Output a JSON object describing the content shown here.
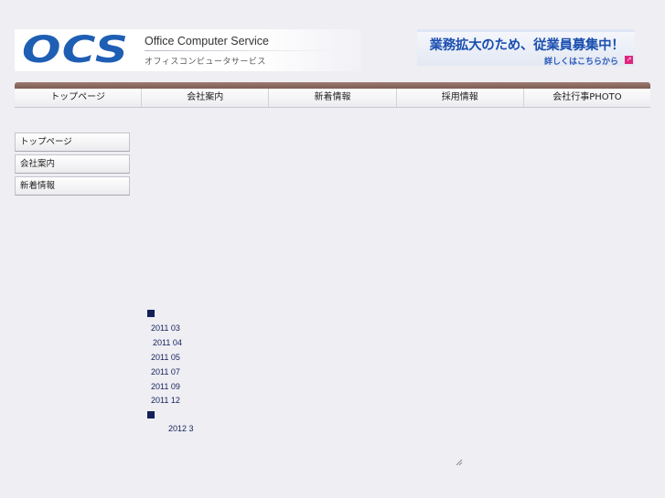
{
  "header": {
    "logo_text": "OCS",
    "company_name_en": "Office Computer Service",
    "company_name_ja": "オフィスコンピュータサービス"
  },
  "banner": {
    "headline": "業務拡大のため、従業員募集中！",
    "link_text": "詳しくはこちらから",
    "arrow_glyph": "↗"
  },
  "top_nav": {
    "items": [
      {
        "label": "トップページ"
      },
      {
        "label": "会社案内"
      },
      {
        "label": "新着情報"
      },
      {
        "label": "採用情報"
      },
      {
        "label": "会社行事PHOTO"
      }
    ]
  },
  "side_nav": {
    "items": [
      {
        "label": "トップページ"
      },
      {
        "label": "会社案内"
      },
      {
        "label": "新着情報"
      }
    ]
  },
  "archive": {
    "group1_links": [
      "2011 03",
      "2011 04",
      "2011 05",
      "2011 07",
      "2011 09",
      "2011 12"
    ],
    "group2_links": [
      "2012 3"
    ]
  },
  "colors": {
    "brand_blue": "#1e5fb4",
    "nav_bar_brown": "#8a6a60",
    "link_navy": "#14205a",
    "banner_arrow_pink": "#e2237e"
  }
}
